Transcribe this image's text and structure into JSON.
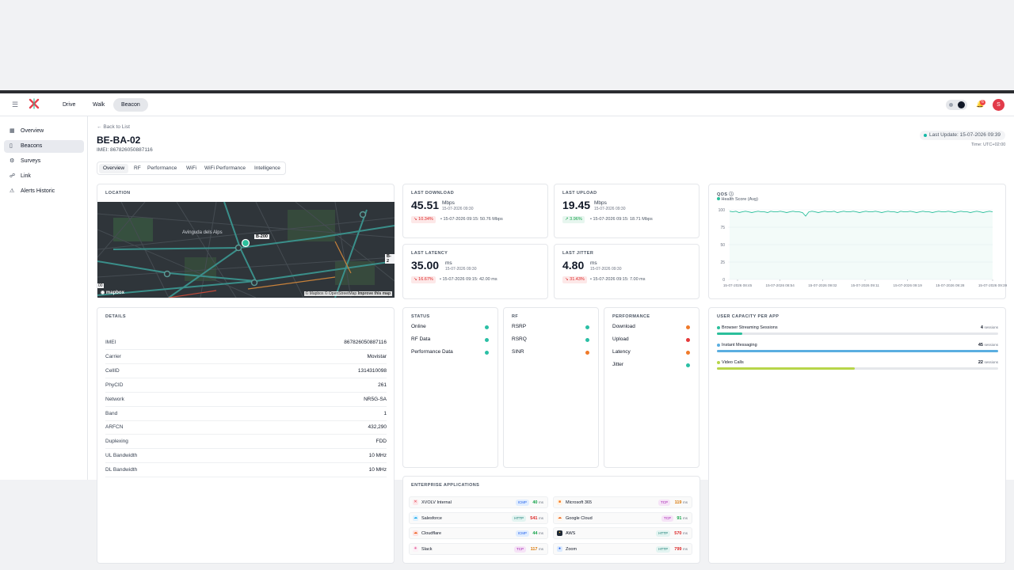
{
  "header": {
    "tabs": [
      {
        "label": "Drive",
        "active": false
      },
      {
        "label": "Walk",
        "active": false
      },
      {
        "label": "Beacon",
        "active": true
      }
    ],
    "notifications_count": "6",
    "avatar_initial": "S"
  },
  "sidebar": {
    "items": [
      {
        "label": "Overview",
        "icon": "grid-icon",
        "active": false
      },
      {
        "label": "Beacons",
        "icon": "device-icon",
        "active": true
      },
      {
        "label": "Surveys",
        "icon": "survey-icon",
        "active": false
      },
      {
        "label": "Link",
        "icon": "link-icon",
        "active": false
      },
      {
        "label": "Alerts Historic",
        "icon": "bell-icon",
        "active": false
      }
    ]
  },
  "page": {
    "back_label": "Back to List",
    "title": "BE-BA-02",
    "imei": "IMEI: 867826050887116",
    "last_update": "Last Update: 15-07-2026 09:39",
    "timezone": "Time: UTC+02:00"
  },
  "subtabs": [
    "Overview",
    "RF",
    "Performance",
    "WiFi",
    "WiFi Performance",
    "Intelligence"
  ],
  "location": {
    "label": "LOCATION",
    "street": "Avinguda dels Alps",
    "road_badge_1": "B-200",
    "road_badge_2": "B-2",
    "scale": "00",
    "logo": "mapbox",
    "attribution": "© Mapbox © OpenStreetMap",
    "improve": "Improve this map"
  },
  "metrics": {
    "download": {
      "label": "LAST DOWNLOAD",
      "value": "45.51",
      "unit": "Mbps",
      "ts": "15-07-2026 09:30",
      "change": "10.34%",
      "direction": "down",
      "prev": "15-07-2026 09:15: 50.76 Mbps"
    },
    "upload": {
      "label": "LAST UPLOAD",
      "value": "19.45",
      "unit": "Mbps",
      "ts": "15-07-2026 09:30",
      "change": "3.96%",
      "direction": "up",
      "prev": "15-07-2026 09:15: 18.71 Mbps"
    },
    "latency": {
      "label": "LAST LATENCY",
      "value": "35.00",
      "unit": "ms",
      "ts": "15-07-2026 09:30",
      "change": "16.67%",
      "direction": "down",
      "prev": "15-07-2026 09:15: 42.00 ms"
    },
    "jitter": {
      "label": "LAST JITTER",
      "value": "4.80",
      "unit": "ms",
      "ts": "15-07-2026 09:30",
      "change": "31.43%",
      "direction": "down",
      "prev": "15-07-2026 09:15: 7.00 ms"
    }
  },
  "qos": {
    "label": "QOS",
    "legend": "Health Score (Avg)",
    "y_ticks": [
      "100",
      "75",
      "50",
      "25",
      "0"
    ],
    "x_ticks": [
      "15-07-2026 08:45",
      "15-07-2026 08:54",
      "15-07-2026 09:02",
      "15-07-2026 09:11",
      "15-07-2026 09:19",
      "15-07-2026 09:28",
      "15-07-2026 09:39"
    ],
    "color": "#2bbf9b"
  },
  "chart_data": {
    "type": "line",
    "title": "QOS",
    "series": [
      {
        "name": "Health Score (Avg)",
        "values": [
          98,
          97,
          98,
          96,
          97,
          98,
          97,
          96,
          97,
          98,
          97,
          97,
          96,
          98,
          97,
          97,
          98,
          97,
          96,
          97,
          98,
          97,
          97,
          96,
          91,
          97,
          98,
          97,
          96,
          97,
          98,
          97,
          97,
          98,
          96,
          97,
          98,
          97,
          97,
          98,
          97,
          96,
          97,
          98,
          97,
          97,
          98,
          97,
          96,
          97,
          98,
          97,
          97,
          96,
          98,
          97,
          97,
          98,
          97,
          96,
          97,
          98,
          97,
          97,
          96,
          97,
          98,
          97,
          97,
          98,
          97,
          96,
          97,
          98,
          97,
          97,
          96,
          97,
          98,
          97,
          96,
          97,
          98,
          97
        ]
      }
    ],
    "ylim": [
      0,
      100
    ],
    "x_range": [
      "15-07-2026 08:45",
      "15-07-2026 09:39"
    ],
    "grid": true
  },
  "details": {
    "label": "DETAILS",
    "rows": [
      {
        "k": "IMEI",
        "v": "867826050887116"
      },
      {
        "k": "Carrier",
        "v": "Movistar"
      },
      {
        "k": "CellID",
        "v": "1314310098"
      },
      {
        "k": "PhyCID",
        "v": "261"
      },
      {
        "k": "Network",
        "v": "NR5G-SA"
      },
      {
        "k": "Band",
        "v": "1"
      },
      {
        "k": "ARFCN",
        "v": "432,290"
      },
      {
        "k": "Duplexing",
        "v": "FDD"
      },
      {
        "k": "UL Bandwidth",
        "v": "10 MHz"
      },
      {
        "k": "DL Bandwidth",
        "v": "10 MHz"
      }
    ]
  },
  "status": {
    "label": "STATUS",
    "rows": [
      {
        "k": "Online",
        "color": "#2bbfa5"
      },
      {
        "k": "RF Data",
        "color": "#2bbfa5"
      },
      {
        "k": "Performance Data",
        "color": "#2bbfa5"
      }
    ]
  },
  "rf": {
    "label": "RF",
    "rows": [
      {
        "k": "RSRP",
        "color": "#2bbfa5"
      },
      {
        "k": "RSRQ",
        "color": "#2bbfa5"
      },
      {
        "k": "SINR",
        "color": "#f07a2a"
      }
    ]
  },
  "performance": {
    "label": "PERFORMANCE",
    "rows": [
      {
        "k": "Download",
        "color": "#f07a2a"
      },
      {
        "k": "Upload",
        "color": "#e5393a"
      },
      {
        "k": "Latency",
        "color": "#f07a2a"
      },
      {
        "k": "Jitter",
        "color": "#2bbfa5"
      }
    ]
  },
  "enterprise": {
    "label": "ENTERPRISE APPLICATIONS",
    "apps": [
      {
        "name": "XVOLV Internal",
        "proto": "ICMP",
        "ms": "40",
        "ms_color": "#16a34a",
        "icon": "xvolv-icon"
      },
      {
        "name": "Microsoft 365",
        "proto": "TCP",
        "ms": "119",
        "ms_color": "#d97706",
        "icon": "microsoft-icon"
      },
      {
        "name": "Salesforce",
        "proto": "HTTP",
        "ms": "541",
        "ms_color": "#dc2626",
        "icon": "cloud-icon"
      },
      {
        "name": "Google Cloud",
        "proto": "TCP",
        "ms": "91",
        "ms_color": "#16a34a",
        "icon": "google-cloud-icon"
      },
      {
        "name": "Cloudflare",
        "proto": "ICMP",
        "ms": "44",
        "ms_color": "#16a34a",
        "icon": "cloudflare-icon"
      },
      {
        "name": "AWS",
        "proto": "HTTP",
        "ms": "570",
        "ms_color": "#dc2626",
        "icon": "aws-icon"
      },
      {
        "name": "Slack",
        "proto": "TCP",
        "ms": "117",
        "ms_color": "#d97706",
        "icon": "slack-icon"
      },
      {
        "name": "Zoom",
        "proto": "HTTP",
        "ms": "799",
        "ms_color": "#dc2626",
        "icon": "zoom-icon"
      }
    ],
    "unit": "ms"
  },
  "capacity": {
    "label": "USER CAPACITY PER APP",
    "unit": "sessions",
    "rows": [
      {
        "name": "Browser Streaming Sessions",
        "value": "4",
        "fraction": 0.09,
        "color": "#2bbf9b"
      },
      {
        "name": "Instant Messaging",
        "value": "45",
        "fraction": 1.0,
        "color": "#5aaee0"
      },
      {
        "name": "Video Calls",
        "value": "22",
        "fraction": 0.49,
        "color": "#b7d54a"
      }
    ]
  },
  "colors": {
    "accent_teal": "#2bbfa5",
    "danger": "#e5393a",
    "warning": "#f07a2a"
  }
}
